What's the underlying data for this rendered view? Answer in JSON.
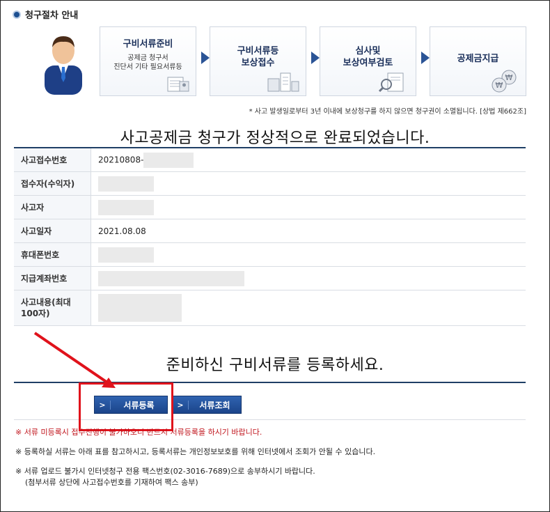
{
  "section": {
    "title": "청구절차 안내"
  },
  "steps": [
    {
      "title": "구비서류준비",
      "sub1": "공제금 청구서",
      "sub2": "진단서 기타 필요서류등"
    },
    {
      "title": "구비서류등",
      "title2": "보상접수"
    },
    {
      "title": "심사및",
      "title2": "보상여부검토"
    },
    {
      "title": "공제금지급"
    }
  ],
  "notice": "* 사고 발생일로부터 3년 이내에 보상청구를 하지 않으면 청구권이 소멸됩니다. [상법 제662조]",
  "headline": "사고공제금 청구가 정상적으로 완료되었습니다.",
  "info_rows": [
    {
      "label": "사고접수번호",
      "value": "20210808-"
    },
    {
      "label": "접수자(수익자)",
      "value": ""
    },
    {
      "label": "사고자",
      "value": ""
    },
    {
      "label": "사고일자",
      "value": "2021.08.08"
    },
    {
      "label": "휴대폰번호",
      "value": ""
    },
    {
      "label": "지급계좌번호",
      "value": ""
    },
    {
      "label": "사고내용(최대 100자)",
      "value": ""
    }
  ],
  "prompt": "준비하신 구비서류를 등록하세요.",
  "buttons": {
    "register": "서류등록",
    "inquiry": "서류조회",
    "chevron": ">"
  },
  "notes": [
    "※ 서류 미등록시 접수진행이 불가하오니 반드시 서류등록을 하시기 바랍니다.",
    "※ 등록하실 서류는 아래 표를 참고하시고, 등록서류는 개인정보보호를 위해 인터넷에서 조회가 안될 수 있습니다.",
    "※ 서류 업로드 불가시 인터넷청구 전용 팩스번호(02-3016-7689)으로 송부하시기 바랍니다.",
    "(첨부서류 상단에 사고접수번호를 기재하여 팩스 송부)"
  ],
  "colors": {
    "accent": "#1f3f66",
    "button": "#1b448a",
    "highlight": "#e0121b",
    "warning": "#c0141c"
  }
}
